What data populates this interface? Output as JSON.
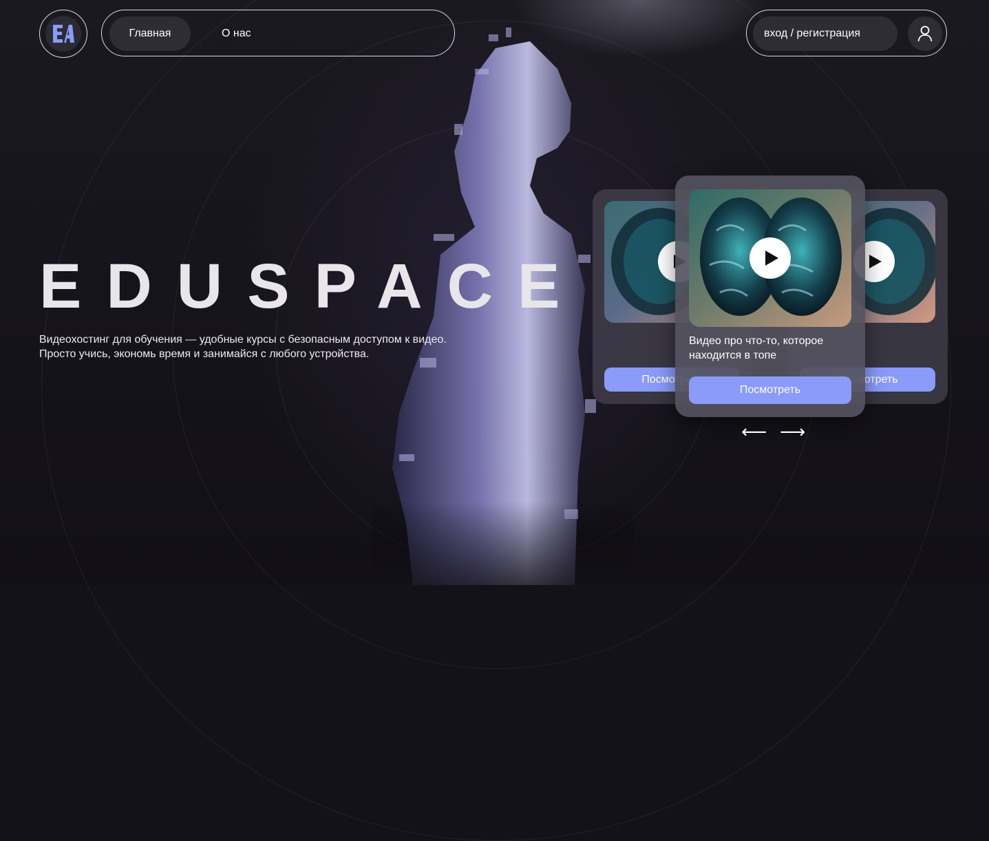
{
  "brand": {
    "logo_icon": "eduspace-logo-icon"
  },
  "nav": {
    "items": [
      {
        "label": "Главная",
        "active": true
      },
      {
        "label": "О нас",
        "active": false
      }
    ]
  },
  "auth": {
    "label": "вход / регистрация",
    "icon": "user-icon"
  },
  "hero": {
    "title": "EDUSPACE",
    "description_line1": "Видеохостинг для обучения — удобные курсы с безопасным доступом к видео.",
    "description_line2": "Просто учись, экономь время и занимайся с любого устройства."
  },
  "carousel": {
    "left_card": {
      "button": "Посмотреть"
    },
    "main_card": {
      "caption": "Видео про что-то, которое находится в топе",
      "button": "Посмотреть"
    },
    "right_card": {
      "button": "Посмотреть"
    },
    "prev_icon": "arrow-left-icon",
    "next_icon": "arrow-right-icon",
    "prev_glyph": "⟵",
    "next_glyph": "⟶"
  },
  "colors": {
    "accent": "#8a9bf9",
    "background": "#141219",
    "card": "#54525e"
  }
}
